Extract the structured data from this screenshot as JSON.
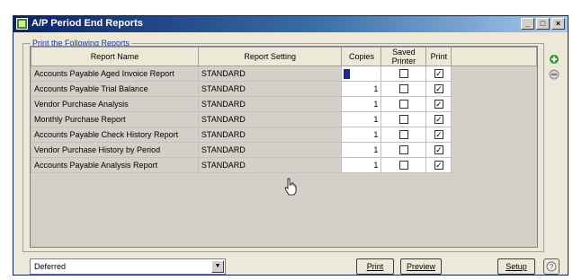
{
  "window": {
    "title": "A/P Period End Reports"
  },
  "group": {
    "legend": "Print the Following Reports"
  },
  "table": {
    "headers": {
      "name": "Report Name",
      "setting": "Report Setting",
      "copies": "Copies",
      "saved_printer": "Saved Printer",
      "print": "Print"
    },
    "rows": [
      {
        "name": "Accounts Payable Aged Invoice Report",
        "setting": "STANDARD",
        "copies": "1",
        "saved_printer": false,
        "print": true,
        "editing": true
      },
      {
        "name": "Accounts Payable Trial Balance",
        "setting": "STANDARD",
        "copies": "1",
        "saved_printer": false,
        "print": true
      },
      {
        "name": "Vendor Purchase Analysis",
        "setting": "STANDARD",
        "copies": "1",
        "saved_printer": false,
        "print": true
      },
      {
        "name": "Monthly Purchase Report",
        "setting": "STANDARD",
        "copies": "1",
        "saved_printer": false,
        "print": true
      },
      {
        "name": "Accounts Payable Check History Report",
        "setting": "STANDARD",
        "copies": "1",
        "saved_printer": false,
        "print": true
      },
      {
        "name": "Vendor Purchase History by Period",
        "setting": "STANDARD",
        "copies": "1",
        "saved_printer": false,
        "print": true
      },
      {
        "name": "Accounts Payable Analysis Report",
        "setting": "STANDARD",
        "copies": "1",
        "saved_printer": false,
        "print": true
      }
    ]
  },
  "footer": {
    "mode": "Deferred",
    "buttons": {
      "print": "Print",
      "preview": "Preview",
      "setup": "Setup"
    }
  },
  "colors": {
    "title_start": "#0a246a",
    "title_end": "#a6caf0",
    "accent": "#2030a0"
  },
  "icons": {
    "app": "report-app-icon",
    "add": "add-row-icon",
    "remove": "delete-row-icon",
    "help": "help-icon"
  }
}
